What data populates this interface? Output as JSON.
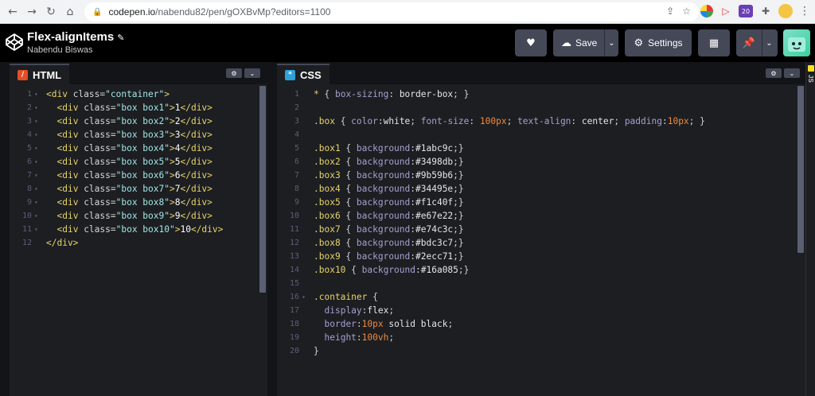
{
  "browser": {
    "url_host": "codepen.io",
    "url_path": "/nabendu82/pen/gOXBvMp?editors=1100",
    "ext_badge": "20"
  },
  "header": {
    "pen_title": "Flex-alignItems",
    "author": "Nabendu Biswas",
    "save_label": "Save",
    "settings_label": "Settings"
  },
  "html_editor": {
    "tab_label": "HTML",
    "lines": [
      {
        "n": "1",
        "fold": true,
        "indent": 0,
        "tokens": [
          [
            "t-tag",
            "<div "
          ],
          [
            "t-attr",
            "class"
          ],
          [
            "t-punc",
            "="
          ],
          [
            "t-str",
            "\"container\""
          ],
          [
            "t-tag",
            ">"
          ]
        ]
      },
      {
        "n": "2",
        "fold": true,
        "indent": 1,
        "tokens": [
          [
            "t-tag",
            "<div "
          ],
          [
            "t-attr",
            "class"
          ],
          [
            "t-punc",
            "="
          ],
          [
            "t-str",
            "\"box box1\""
          ],
          [
            "t-tag",
            ">"
          ],
          [
            "t-text",
            "1"
          ],
          [
            "t-tag",
            "</div>"
          ]
        ]
      },
      {
        "n": "3",
        "fold": true,
        "indent": 1,
        "tokens": [
          [
            "t-tag",
            "<div "
          ],
          [
            "t-attr",
            "class"
          ],
          [
            "t-punc",
            "="
          ],
          [
            "t-str",
            "\"box box2\""
          ],
          [
            "t-tag",
            ">"
          ],
          [
            "t-text",
            "2"
          ],
          [
            "t-tag",
            "</div>"
          ]
        ]
      },
      {
        "n": "4",
        "fold": true,
        "indent": 1,
        "tokens": [
          [
            "t-tag",
            "<div "
          ],
          [
            "t-attr",
            "class"
          ],
          [
            "t-punc",
            "="
          ],
          [
            "t-str",
            "\"box box3\""
          ],
          [
            "t-tag",
            ">"
          ],
          [
            "t-text",
            "3"
          ],
          [
            "t-tag",
            "</div>"
          ]
        ]
      },
      {
        "n": "5",
        "fold": true,
        "indent": 1,
        "tokens": [
          [
            "t-tag",
            "<div "
          ],
          [
            "t-attr",
            "class"
          ],
          [
            "t-punc",
            "="
          ],
          [
            "t-str",
            "\"box box4\""
          ],
          [
            "t-tag",
            ">"
          ],
          [
            "t-text",
            "4"
          ],
          [
            "t-tag",
            "</div>"
          ]
        ]
      },
      {
        "n": "6",
        "fold": true,
        "indent": 1,
        "tokens": [
          [
            "t-tag",
            "<div "
          ],
          [
            "t-attr",
            "class"
          ],
          [
            "t-punc",
            "="
          ],
          [
            "t-str",
            "\"box box5\""
          ],
          [
            "t-tag",
            ">"
          ],
          [
            "t-text",
            "5"
          ],
          [
            "t-tag",
            "</div>"
          ]
        ]
      },
      {
        "n": "7",
        "fold": true,
        "indent": 1,
        "tokens": [
          [
            "t-tag",
            "<div "
          ],
          [
            "t-attr",
            "class"
          ],
          [
            "t-punc",
            "="
          ],
          [
            "t-str",
            "\"box box6\""
          ],
          [
            "t-tag",
            ">"
          ],
          [
            "t-text",
            "6"
          ],
          [
            "t-tag",
            "</div>"
          ]
        ]
      },
      {
        "n": "8",
        "fold": true,
        "indent": 1,
        "tokens": [
          [
            "t-tag",
            "<div "
          ],
          [
            "t-attr",
            "class"
          ],
          [
            "t-punc",
            "="
          ],
          [
            "t-str",
            "\"box box7\""
          ],
          [
            "t-tag",
            ">"
          ],
          [
            "t-text",
            "7"
          ],
          [
            "t-tag",
            "</div>"
          ]
        ]
      },
      {
        "n": "9",
        "fold": true,
        "indent": 1,
        "tokens": [
          [
            "t-tag",
            "<div "
          ],
          [
            "t-attr",
            "class"
          ],
          [
            "t-punc",
            "="
          ],
          [
            "t-str",
            "\"box box8\""
          ],
          [
            "t-tag",
            ">"
          ],
          [
            "t-text",
            "8"
          ],
          [
            "t-tag",
            "</div>"
          ]
        ]
      },
      {
        "n": "10",
        "fold": true,
        "indent": 1,
        "tokens": [
          [
            "t-tag",
            "<div "
          ],
          [
            "t-attr",
            "class"
          ],
          [
            "t-punc",
            "="
          ],
          [
            "t-str",
            "\"box box9\""
          ],
          [
            "t-tag",
            ">"
          ],
          [
            "t-text",
            "9"
          ],
          [
            "t-tag",
            "</div>"
          ]
        ]
      },
      {
        "n": "11",
        "fold": true,
        "indent": 1,
        "tokens": [
          [
            "t-tag",
            "<div "
          ],
          [
            "t-attr",
            "class"
          ],
          [
            "t-punc",
            "="
          ],
          [
            "t-str",
            "\"box box10\""
          ],
          [
            "t-tag",
            ">"
          ],
          [
            "t-text",
            "10"
          ],
          [
            "t-tag",
            "</div>"
          ]
        ]
      },
      {
        "n": "12",
        "fold": false,
        "indent": 0,
        "tokens": [
          [
            "t-tag",
            "</div>"
          ]
        ]
      }
    ]
  },
  "css_editor": {
    "tab_label": "CSS",
    "lines": [
      {
        "n": "1",
        "fold": false,
        "indent": 0,
        "tokens": [
          [
            "t-sel",
            "* "
          ],
          [
            "t-punc",
            "{ "
          ],
          [
            "t-prop",
            "box-sizing"
          ],
          [
            "t-punc",
            ": "
          ],
          [
            "t-val",
            "border-box"
          ],
          [
            "t-punc",
            "; }"
          ]
        ]
      },
      {
        "n": "2",
        "fold": false,
        "indent": 0,
        "tokens": []
      },
      {
        "n": "3",
        "fold": false,
        "indent": 0,
        "tokens": [
          [
            "t-sel",
            ".box "
          ],
          [
            "t-punc",
            "{ "
          ],
          [
            "t-prop",
            "color"
          ],
          [
            "t-punc",
            ":"
          ],
          [
            "t-val",
            "white"
          ],
          [
            "t-punc",
            "; "
          ],
          [
            "t-prop",
            "font-size"
          ],
          [
            "t-punc",
            ": "
          ],
          [
            "t-num",
            "100px"
          ],
          [
            "t-punc",
            "; "
          ],
          [
            "t-prop",
            "text-align"
          ],
          [
            "t-punc",
            ": "
          ],
          [
            "t-val",
            "center"
          ],
          [
            "t-punc",
            "; "
          ],
          [
            "t-prop",
            "padding"
          ],
          [
            "t-punc",
            ":"
          ],
          [
            "t-num",
            "10px"
          ],
          [
            "t-punc",
            "; }"
          ]
        ]
      },
      {
        "n": "4",
        "fold": false,
        "indent": 0,
        "tokens": []
      },
      {
        "n": "5",
        "fold": false,
        "indent": 0,
        "tokens": [
          [
            "t-sel",
            ".box1 "
          ],
          [
            "t-punc",
            "{ "
          ],
          [
            "t-prop",
            "background"
          ],
          [
            "t-punc",
            ":"
          ],
          [
            "t-val",
            "#1abc9c"
          ],
          [
            "t-punc",
            ";}"
          ]
        ]
      },
      {
        "n": "6",
        "fold": false,
        "indent": 0,
        "tokens": [
          [
            "t-sel",
            ".box2 "
          ],
          [
            "t-punc",
            "{ "
          ],
          [
            "t-prop",
            "background"
          ],
          [
            "t-punc",
            ":"
          ],
          [
            "t-val",
            "#3498db"
          ],
          [
            "t-punc",
            ";}"
          ]
        ]
      },
      {
        "n": "7",
        "fold": false,
        "indent": 0,
        "tokens": [
          [
            "t-sel",
            ".box3 "
          ],
          [
            "t-punc",
            "{ "
          ],
          [
            "t-prop",
            "background"
          ],
          [
            "t-punc",
            ":"
          ],
          [
            "t-val",
            "#9b59b6"
          ],
          [
            "t-punc",
            ";}"
          ]
        ]
      },
      {
        "n": "8",
        "fold": false,
        "indent": 0,
        "tokens": [
          [
            "t-sel",
            ".box4 "
          ],
          [
            "t-punc",
            "{ "
          ],
          [
            "t-prop",
            "background"
          ],
          [
            "t-punc",
            ":"
          ],
          [
            "t-val",
            "#34495e"
          ],
          [
            "t-punc",
            ";}"
          ]
        ]
      },
      {
        "n": "9",
        "fold": false,
        "indent": 0,
        "tokens": [
          [
            "t-sel",
            ".box5 "
          ],
          [
            "t-punc",
            "{ "
          ],
          [
            "t-prop",
            "background"
          ],
          [
            "t-punc",
            ":"
          ],
          [
            "t-val",
            "#f1c40f"
          ],
          [
            "t-punc",
            ";}"
          ]
        ]
      },
      {
        "n": "10",
        "fold": false,
        "indent": 0,
        "tokens": [
          [
            "t-sel",
            ".box6 "
          ],
          [
            "t-punc",
            "{ "
          ],
          [
            "t-prop",
            "background"
          ],
          [
            "t-punc",
            ":"
          ],
          [
            "t-val",
            "#e67e22"
          ],
          [
            "t-punc",
            ";}"
          ]
        ]
      },
      {
        "n": "11",
        "fold": false,
        "indent": 0,
        "tokens": [
          [
            "t-sel",
            ".box7 "
          ],
          [
            "t-punc",
            "{ "
          ],
          [
            "t-prop",
            "background"
          ],
          [
            "t-punc",
            ":"
          ],
          [
            "t-val",
            "#e74c3c"
          ],
          [
            "t-punc",
            ";}"
          ]
        ]
      },
      {
        "n": "12",
        "fold": false,
        "indent": 0,
        "tokens": [
          [
            "t-sel",
            ".box8 "
          ],
          [
            "t-punc",
            "{ "
          ],
          [
            "t-prop",
            "background"
          ],
          [
            "t-punc",
            ":"
          ],
          [
            "t-val",
            "#bdc3c7"
          ],
          [
            "t-punc",
            ";}"
          ]
        ]
      },
      {
        "n": "13",
        "fold": false,
        "indent": 0,
        "tokens": [
          [
            "t-sel",
            ".box9 "
          ],
          [
            "t-punc",
            "{ "
          ],
          [
            "t-prop",
            "background"
          ],
          [
            "t-punc",
            ":"
          ],
          [
            "t-val",
            "#2ecc71"
          ],
          [
            "t-punc",
            ";}"
          ]
        ]
      },
      {
        "n": "14",
        "fold": false,
        "indent": 0,
        "tokens": [
          [
            "t-sel",
            ".box10 "
          ],
          [
            "t-punc",
            "{ "
          ],
          [
            "t-prop",
            "background"
          ],
          [
            "t-punc",
            ":"
          ],
          [
            "t-val",
            "#16a085"
          ],
          [
            "t-punc",
            ";}"
          ]
        ]
      },
      {
        "n": "15",
        "fold": false,
        "indent": 0,
        "tokens": []
      },
      {
        "n": "16",
        "fold": true,
        "indent": 0,
        "tokens": [
          [
            "t-sel",
            ".container "
          ],
          [
            "t-punc",
            "{"
          ]
        ]
      },
      {
        "n": "17",
        "fold": false,
        "indent": 1,
        "tokens": [
          [
            "t-prop",
            "display"
          ],
          [
            "t-punc",
            ":"
          ],
          [
            "t-val",
            "flex"
          ],
          [
            "t-punc",
            ";"
          ]
        ]
      },
      {
        "n": "18",
        "fold": false,
        "indent": 1,
        "tokens": [
          [
            "t-prop",
            "border"
          ],
          [
            "t-punc",
            ":"
          ],
          [
            "t-num",
            "10px"
          ],
          [
            "t-val",
            " solid black"
          ],
          [
            "t-punc",
            ";"
          ]
        ]
      },
      {
        "n": "19",
        "fold": false,
        "indent": 1,
        "tokens": [
          [
            "t-prop",
            "height"
          ],
          [
            "t-punc",
            ":"
          ],
          [
            "t-num",
            "100vh"
          ],
          [
            "t-punc",
            ";"
          ]
        ]
      },
      {
        "n": "20",
        "fold": false,
        "indent": 0,
        "tokens": [
          [
            "t-punc",
            "}"
          ]
        ]
      }
    ]
  },
  "js_collapsed_label": "JS",
  "icons": {
    "back": "arrow-left-icon",
    "forward": "arrow-right-icon",
    "reload": "reload-icon",
    "home": "home-icon",
    "lock": "lock-icon",
    "share": "share-icon",
    "star": "star-icon",
    "heart": "heart-icon",
    "cloud": "cloud-icon",
    "gear": "gear-icon",
    "layout": "layout-icon",
    "pin": "pin-icon"
  },
  "colors": {
    "accent_html": "#e44d26",
    "accent_css": "#2ea1d9",
    "header_btn": "#444857",
    "editor_bg": "#1d1e22"
  }
}
